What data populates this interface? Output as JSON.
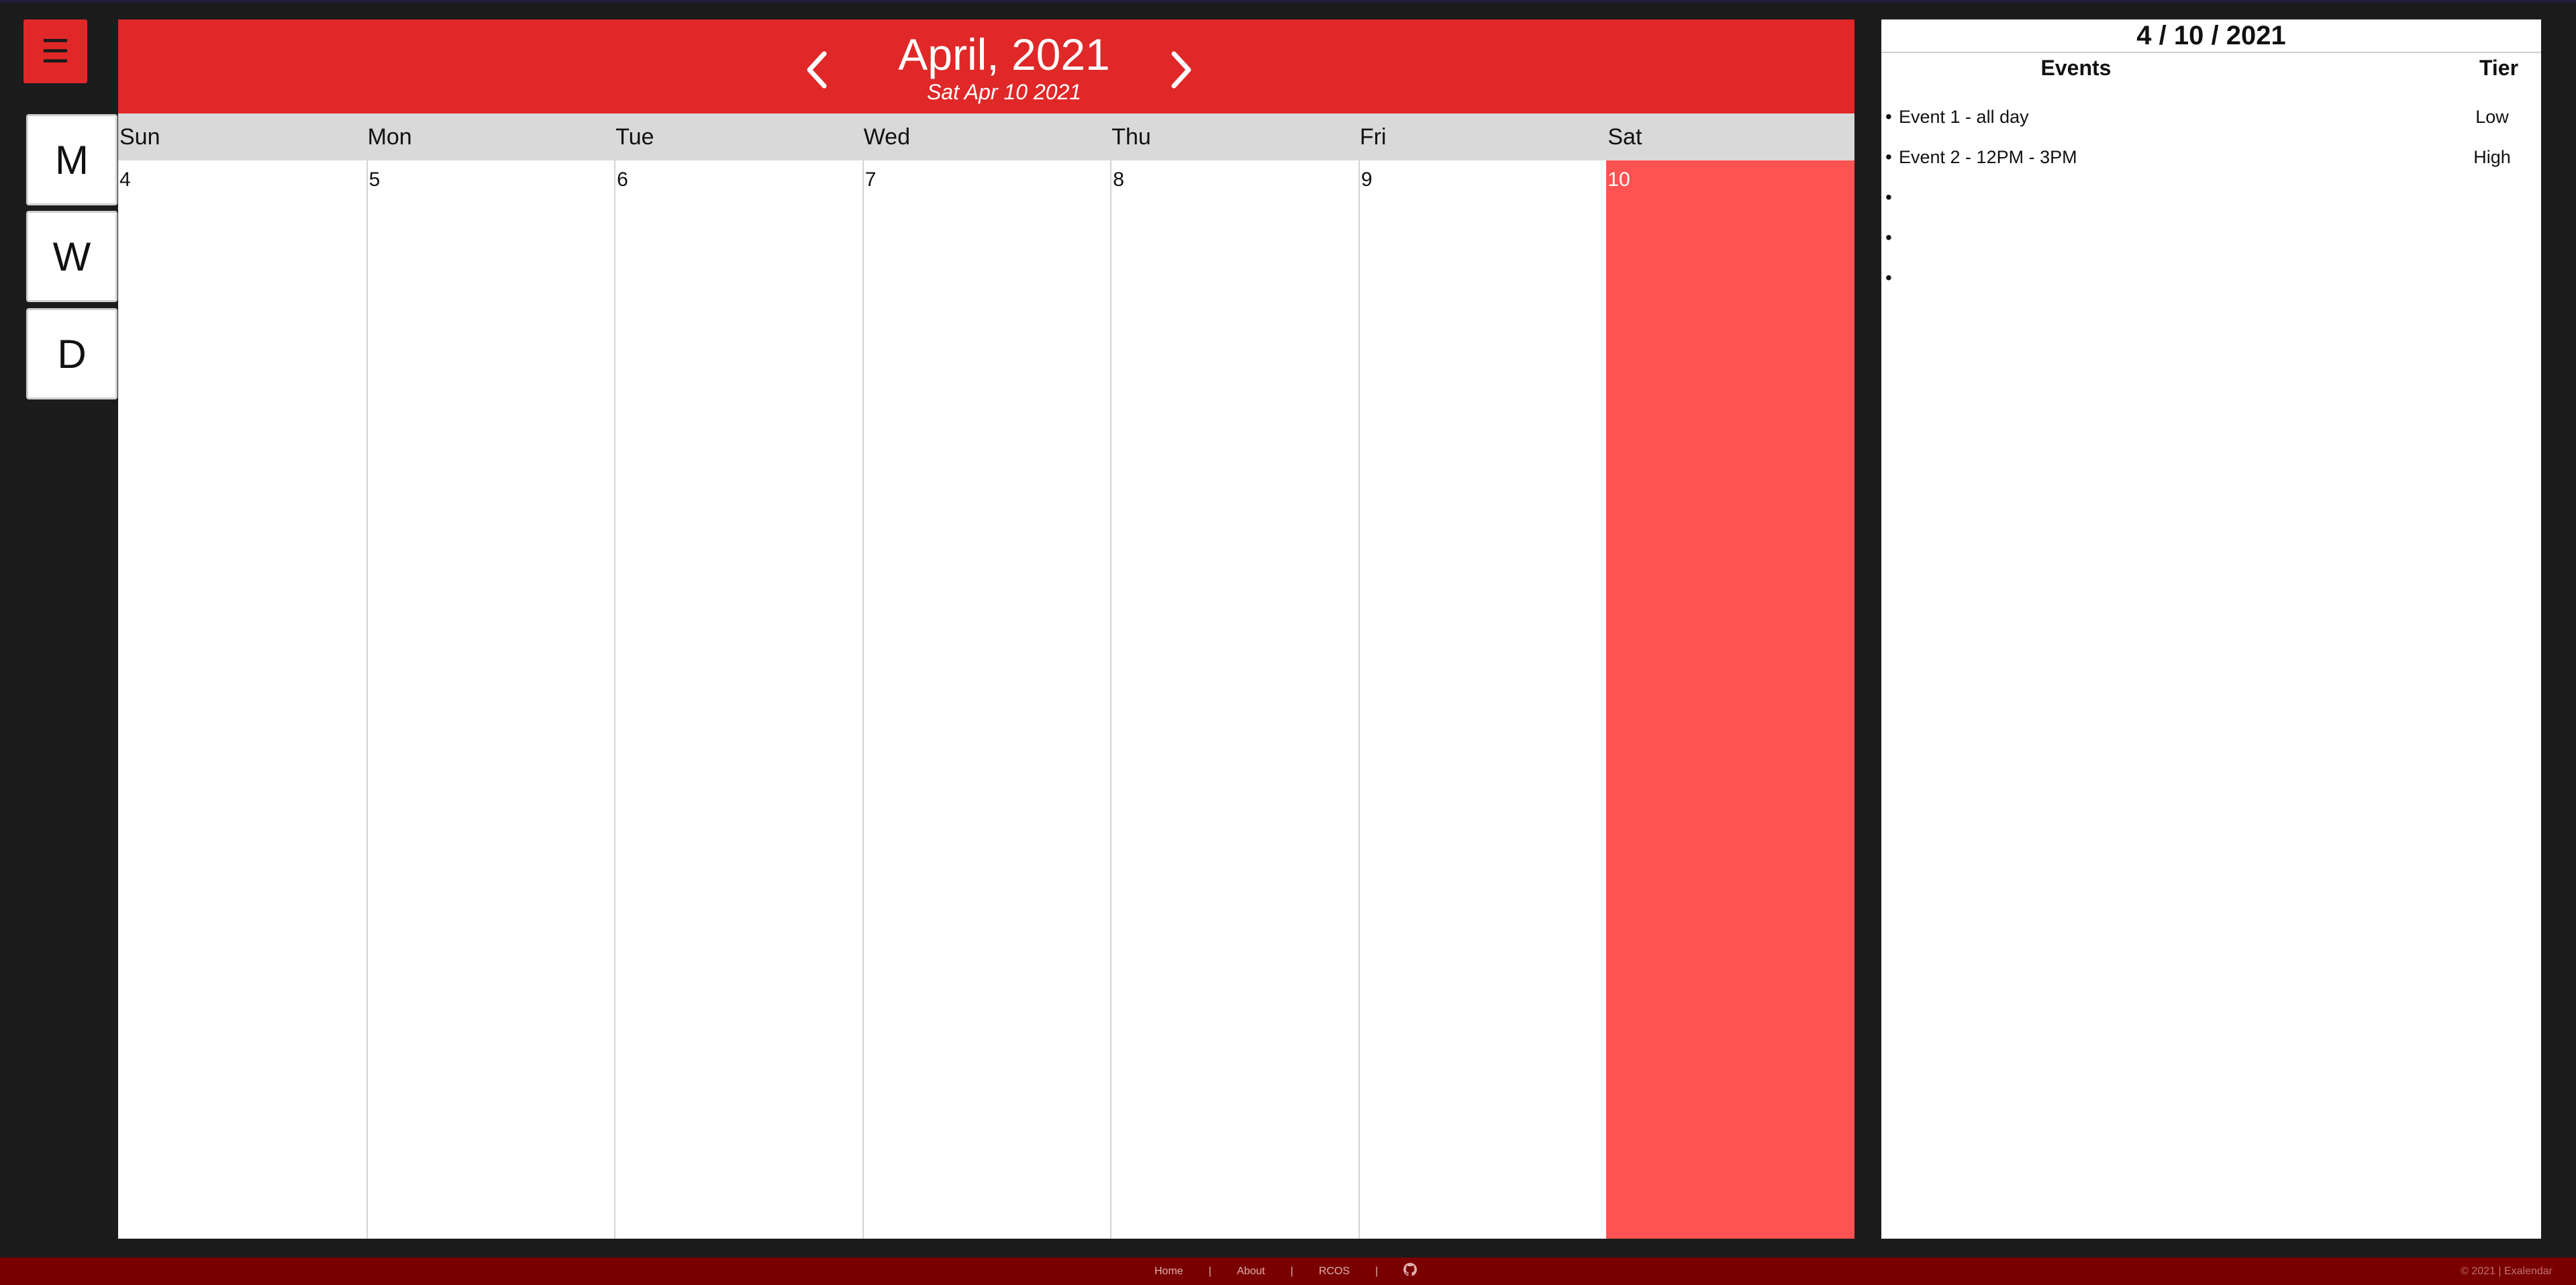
{
  "menu": {
    "icon": "☰"
  },
  "views": {
    "month": "M",
    "week": "W",
    "day": "D"
  },
  "calendar": {
    "title": "April, 2021",
    "subtitle": "Sat Apr 10 2021",
    "days": [
      "Sun",
      "Mon",
      "Tue",
      "Wed",
      "Thu",
      "Fri",
      "Sat"
    ],
    "dates": [
      "4",
      "5",
      "6",
      "7",
      "8",
      "9",
      "10"
    ],
    "selected_index": 6,
    "accent": "#e02828",
    "selected_color": "#ff5252"
  },
  "panel": {
    "date": "4 / 10 / 2021",
    "col_events": "Events",
    "col_tier": "Tier",
    "events": [
      {
        "name": "Event 1 - all day",
        "tier": "Low"
      },
      {
        "name": "Event 2 - 12PM - 3PM",
        "tier": "High"
      },
      {
        "name": "",
        "tier": ""
      },
      {
        "name": "",
        "tier": ""
      },
      {
        "name": "",
        "tier": ""
      }
    ]
  },
  "footer": {
    "links": [
      "Home",
      "About",
      "RCOS"
    ],
    "github_icon": "github-icon",
    "copyright": "© 2021 | Exalendar"
  }
}
